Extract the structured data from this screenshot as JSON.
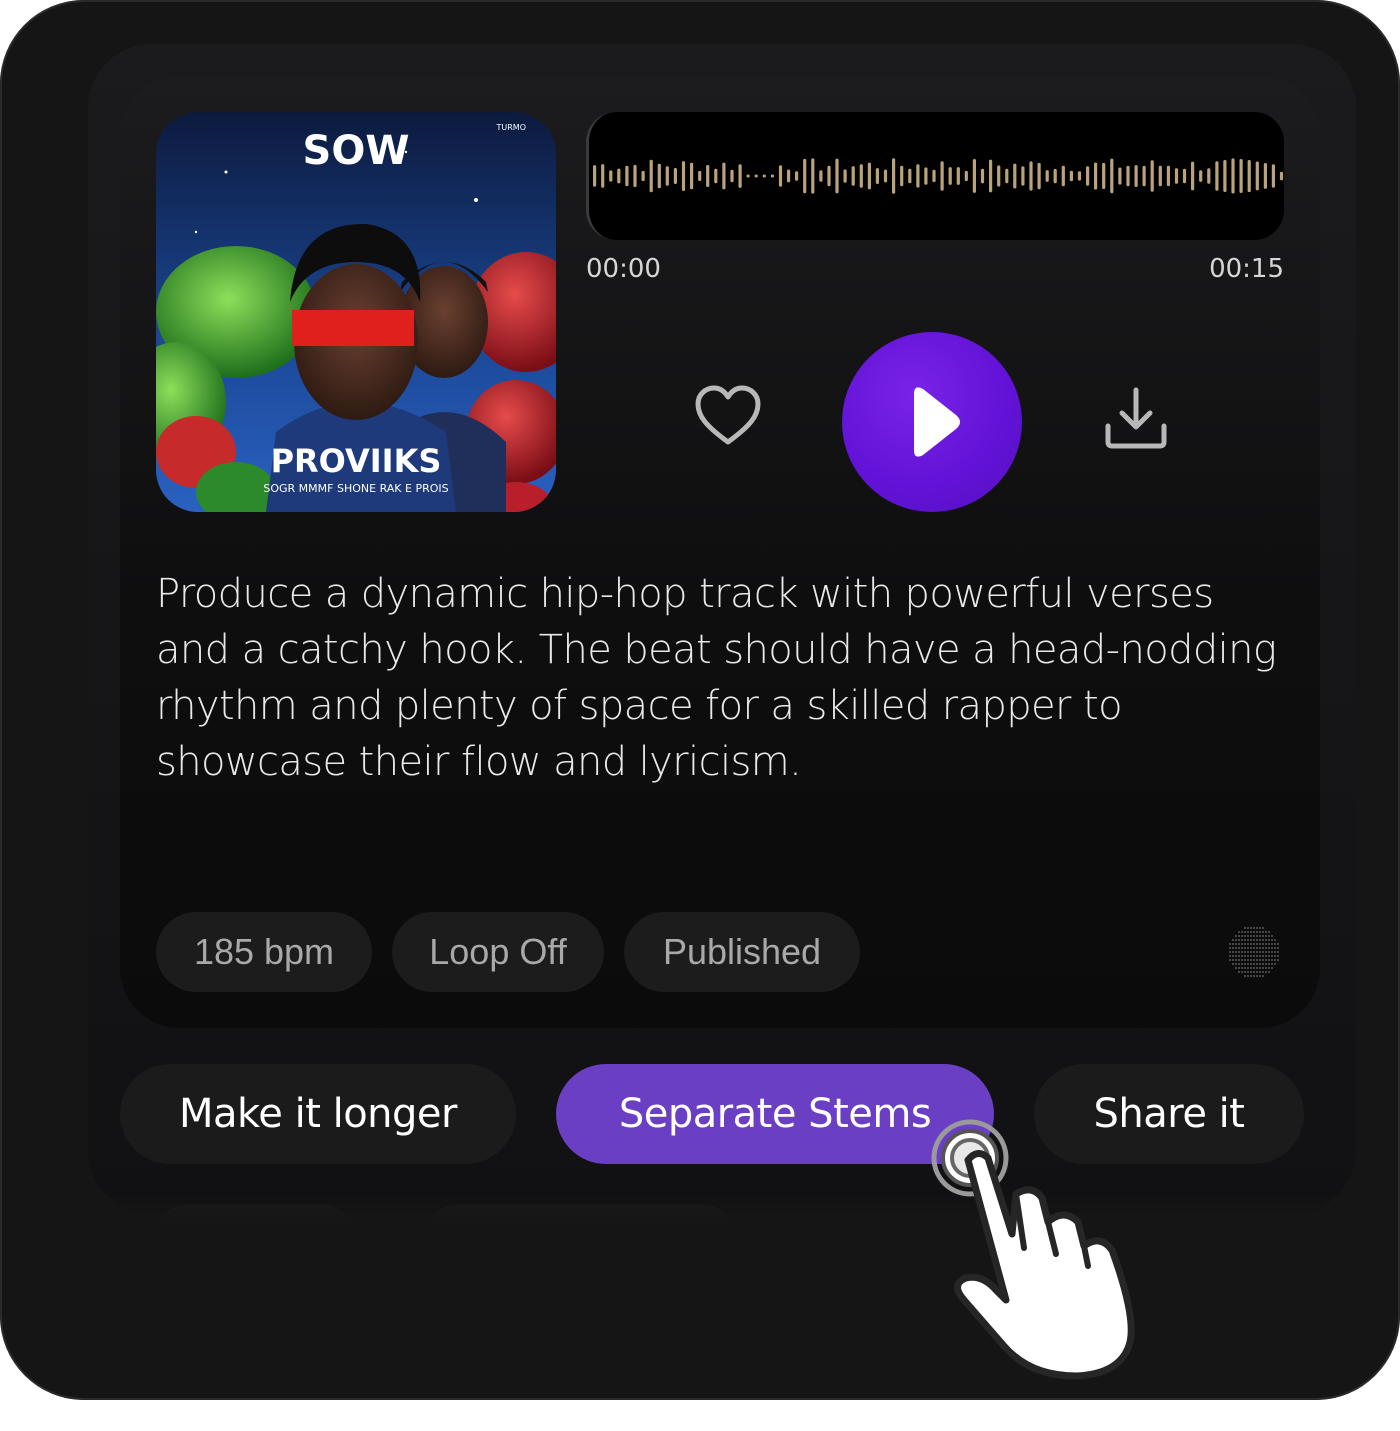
{
  "player": {
    "cover": {
      "title": "SOW",
      "subtitle": "PROVIIKS",
      "caption": "SOGR MMMF SHONE RAK E PROIS",
      "corner_text": "TURMO"
    },
    "time_start": "00:00",
    "time_end": "00:15",
    "like_icon": "heart-icon",
    "play_icon": "play-icon",
    "download_icon": "download-icon"
  },
  "description": "Produce a dynamic hip-hop track with powerful verses and a catchy hook. The beat should have a head-nodding rhythm and plenty of space for a skilled rapper to showcase their flow and lyricism.",
  "tags": [
    {
      "label": "185 bpm"
    },
    {
      "label": "Loop Off"
    },
    {
      "label": "Published"
    }
  ],
  "actions": {
    "longer": "Make it longer",
    "stems": "Separate Stems",
    "share": "Share it"
  },
  "colors": {
    "accent": "#6112d6",
    "stems_button": "#6a3fc4",
    "waveform": "#b9a27c"
  }
}
